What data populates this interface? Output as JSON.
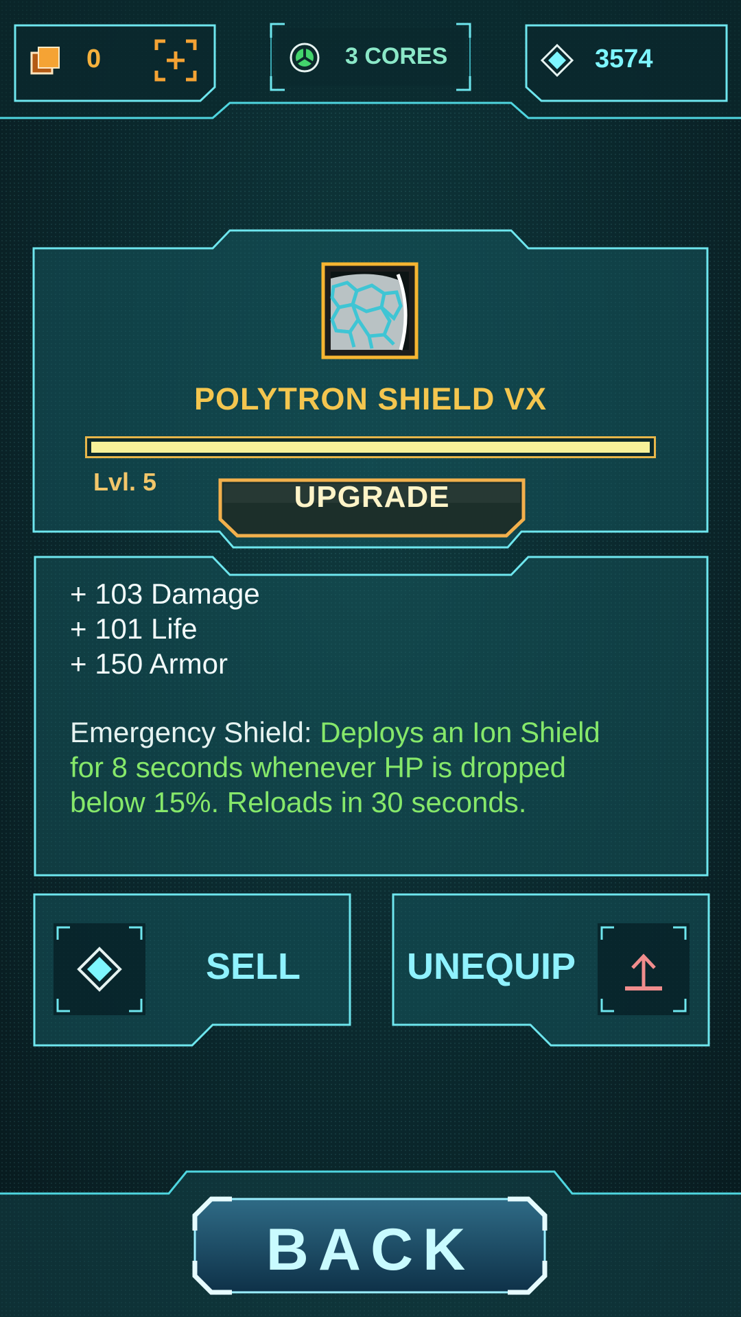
{
  "top_bar": {
    "cards_count": "0",
    "cores_label": "3 CORES",
    "gems_count": "3574"
  },
  "item": {
    "name": "POLYTRON SHIELD VX",
    "level": "Lvl. 5",
    "progress": 1.0,
    "upgrade_label": "UPGRADE"
  },
  "stats": {
    "lines": [
      "+ 103 Damage",
      "+ 101 Life",
      "+ 150 Armor"
    ],
    "ability_name": "Emergency Shield: ",
    "ability_desc": "Deploys an Ion Shield for 8 seconds whenever HP is dropped below 15%. Reloads in 30 seconds."
  },
  "actions": {
    "sell_label": "SELL",
    "unequip_label": "UNEQUIP",
    "back_label": "BACK"
  },
  "colors": {
    "accent_cyan": "#7ef6ff",
    "accent_gold": "#f4c64f",
    "ability_green": "#86e86a",
    "unequip_icon": "#f08d8d"
  }
}
